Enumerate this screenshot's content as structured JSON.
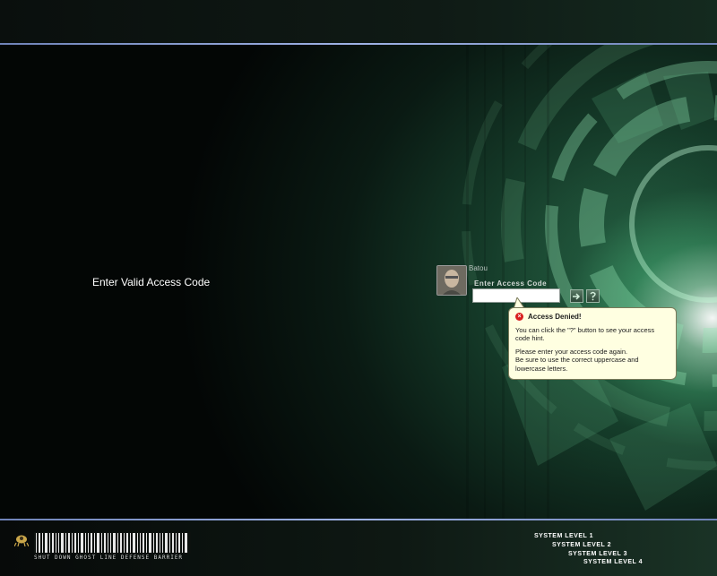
{
  "login": {
    "prompt": "Enter Valid Access Code",
    "username": "Batou",
    "code_label": "Enter Access Code",
    "code_value": ""
  },
  "buttons": {
    "submit_icon": "arrow-enter-icon",
    "hint_icon": "hint-question-icon"
  },
  "balloon": {
    "title": "Access Denied!",
    "line1": "You can click the \"?\" button to see your access code hint.",
    "line2": "Please enter your access code again.",
    "line3": "Be sure to use the correct uppercase and lowercase letters."
  },
  "footer": {
    "barcode_caption": "SHUT DOWN GHOST LINE DEFENSE BARRIER",
    "levels": [
      "SYSTEM LEVEL 1",
      "SYSTEM LEVEL 2",
      "SYSTEM LEVEL 3",
      "SYSTEM LEVEL 4"
    ]
  },
  "colors": {
    "accent_line": "#9fb3e6",
    "balloon_bg": "#ffffe1",
    "error_red": "#d81f1f",
    "glow_green": "#2b6a4a"
  }
}
